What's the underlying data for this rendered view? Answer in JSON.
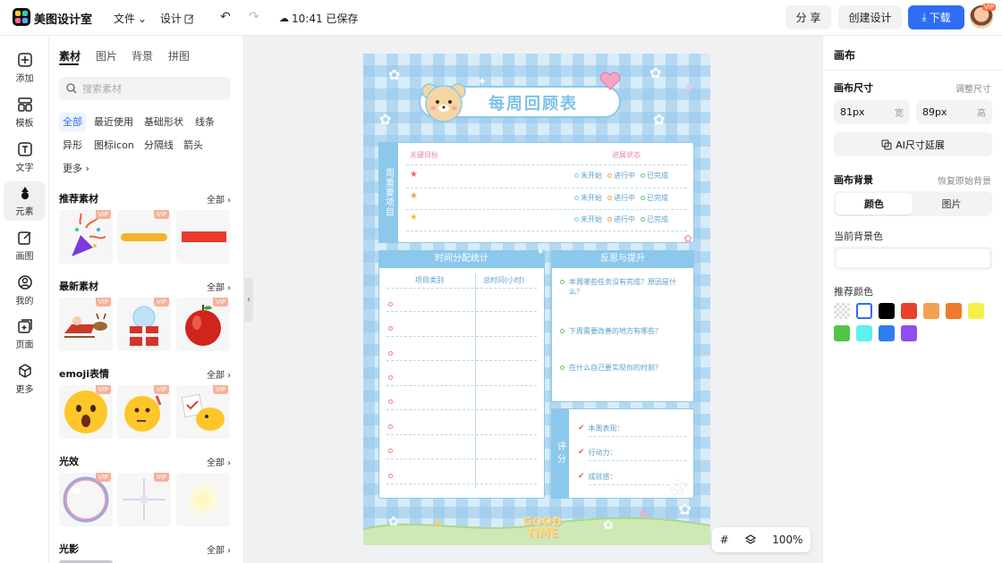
{
  "topbar": {
    "brand": "美图设计室",
    "menu_file": "文件",
    "menu_design": "设计",
    "save_status": "10:41 已保存",
    "share": "分 享",
    "create": "创建设计",
    "download": "下载",
    "vip_badge": "VIP"
  },
  "rail": [
    {
      "label": "添加",
      "icon": "plus-square-icon"
    },
    {
      "label": "模板",
      "icon": "template-icon"
    },
    {
      "label": "文字",
      "icon": "text-icon"
    },
    {
      "label": "元素",
      "icon": "shapes-icon",
      "active": true
    },
    {
      "label": "画图",
      "icon": "draw-icon"
    },
    {
      "label": "我的",
      "icon": "user-icon"
    },
    {
      "label": "页面",
      "icon": "page-add-icon"
    },
    {
      "label": "更多",
      "icon": "cube-icon"
    }
  ],
  "assets": {
    "tabs": [
      "素材",
      "图片",
      "背景",
      "拼图"
    ],
    "active_tab": "素材",
    "search_placeholder": "搜索素材",
    "chips": [
      "全部",
      "最近使用",
      "基础形状",
      "线条",
      "异形",
      "图标icon",
      "分隔线",
      "箭头",
      "更多"
    ],
    "active_chip": "全部",
    "all_label": "全部",
    "vip": "VIP",
    "sections": [
      "推荐素材",
      "最新素材",
      "emoji表情",
      "光效",
      "光影"
    ]
  },
  "poster": {
    "title": "每周回顾表",
    "sec1_label": "周重要项目",
    "sec1_col1": "关键目标",
    "sec1_col2": "进展状态",
    "status": [
      "未开始",
      "进行中",
      "已完成"
    ],
    "sec2_title": "时间分配统计",
    "sec2_col1": "项目类别",
    "sec2_col2": "总时间(小时)",
    "sec3_title": "反思与提升",
    "q1": "本周哪些任务没有完成？原因是什么？",
    "q2": "下周需要改善的地方有哪些？",
    "q3": "在什么自己要实现你的时刻？",
    "sec4_label": "评分",
    "score1": "本周表现：",
    "score2": "行动力：",
    "score3": "成就感：",
    "footer_text": "GOOD TIME"
  },
  "zoom": "100%",
  "props": {
    "title": "画布",
    "size_label": "画布尺寸",
    "resize_link": "调整尺寸",
    "width_value": "81px",
    "width_unit": "宽",
    "height_value": "89px",
    "height_unit": "高",
    "ai_extend": "AI尺寸延展",
    "bg_label": "画布背景",
    "restore_link": "恢复原始背景",
    "seg_color": "颜色",
    "seg_image": "图片",
    "current_bg_label": "当前背景色",
    "recommended_label": "推荐颜色"
  },
  "colors": {
    "accent": "#2f6df6",
    "swatches": [
      "transparent",
      "#ffffff",
      "#000000",
      "#e8402a",
      "#f2a24e",
      "#f07b2a",
      "#f7f04a",
      "#52c548",
      "#5cf0ee",
      "#2f7ef0",
      "#8f4ef0"
    ]
  }
}
